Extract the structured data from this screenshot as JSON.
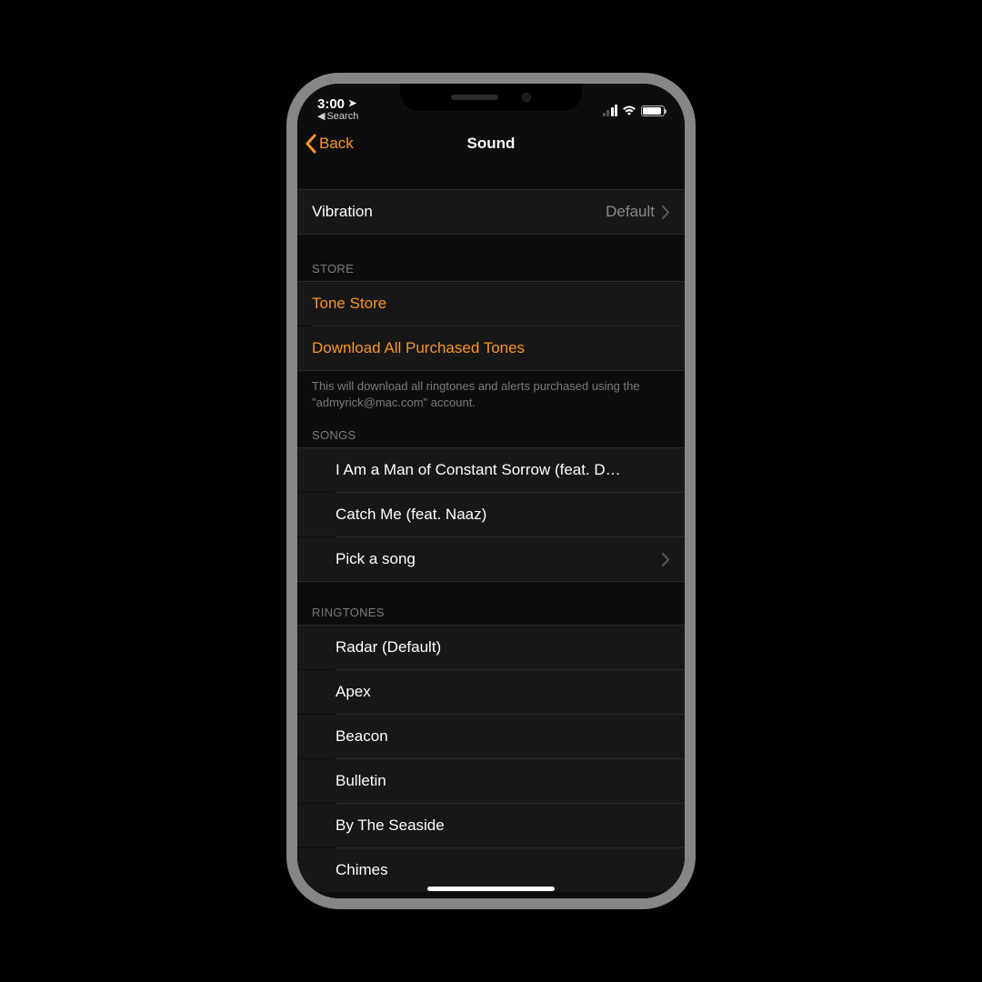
{
  "status": {
    "time": "3:00",
    "breadcrumb": "Search"
  },
  "nav": {
    "back": "Back",
    "title": "Sound"
  },
  "vibration": {
    "label": "Vibration",
    "value": "Default"
  },
  "store": {
    "header": "STORE",
    "tone_store": "Tone Store",
    "download_all": "Download All Purchased Tones",
    "footer": "This will download all ringtones and alerts purchased using the \"admyrick@mac.com\" account."
  },
  "songs": {
    "header": "SONGS",
    "items": [
      "I Am a Man of Constant Sorrow (feat. D…",
      "Catch Me (feat. Naaz)"
    ],
    "pick": "Pick a song"
  },
  "ringtones": {
    "header": "RINGTONES",
    "items": [
      "Radar (Default)",
      "Apex",
      "Beacon",
      "Bulletin",
      "By The Seaside",
      "Chimes"
    ]
  }
}
